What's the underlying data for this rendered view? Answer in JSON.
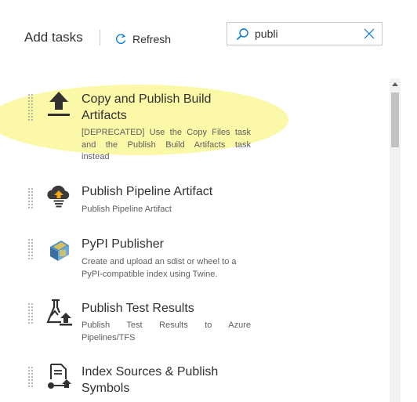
{
  "header": {
    "title": "Add tasks",
    "refresh_label": "Refresh",
    "refresh_icon": "refresh-icon"
  },
  "search": {
    "value": "publi",
    "search_icon": "search-icon",
    "clear_icon": "close-icon"
  },
  "tasks": [
    {
      "title_line1": "Copy and Publish Build",
      "title_line2": "Artifacts",
      "desc_line1": "[DEPRECATED] Use the Copy Files task",
      "desc_line2": "and the Publish Build Artifacts task",
      "desc_line3": "instead",
      "icon": "upload-arrow-icon"
    },
    {
      "title_line1": "Publish Pipeline Artifact",
      "desc_line1": "Publish Pipeline Artifact",
      "icon": "cloud-upload-icon"
    },
    {
      "title_line1": "PyPI Publisher",
      "desc_line1": "Create and upload an sdist or wheel to a",
      "desc_line2": "PyPI-compatible index using Twine.",
      "icon": "python-icon"
    },
    {
      "title_line1": "Publish Test Results",
      "desc_line1": "Publish Test Results to Azure",
      "desc_line2": "Pipelines/TFS",
      "icon": "flask-upload-icon"
    },
    {
      "title_line1": "Index Sources & Publish",
      "title_line2": "Symbols",
      "icon": "document-share-icon"
    }
  ],
  "colors": {
    "highlight": "#fbf8a8",
    "text": "#323130",
    "secondary_text": "#605e5c",
    "accent": "#0078d4"
  }
}
